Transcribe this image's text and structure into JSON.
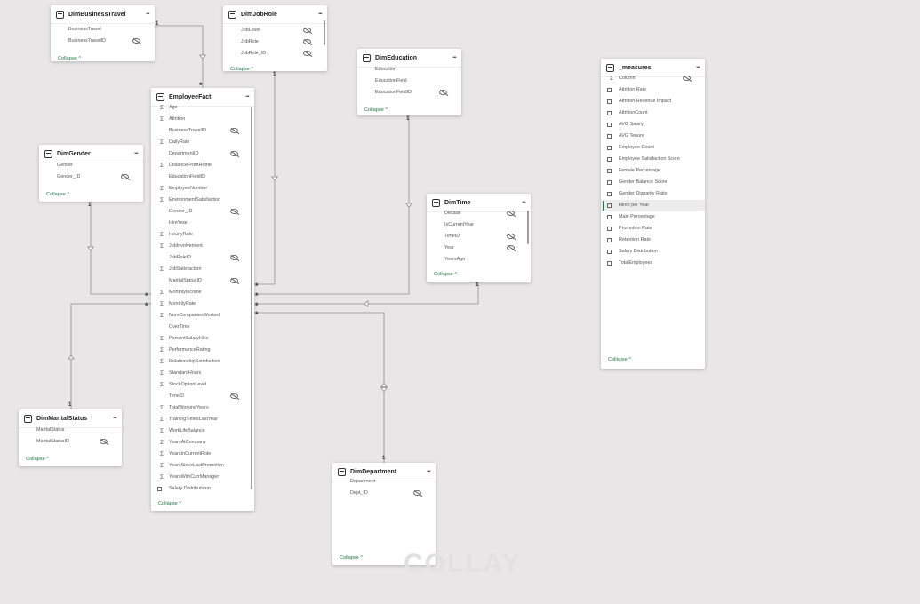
{
  "canvas": {
    "background": "#e8e6e6",
    "line_color": "#a6a6a6",
    "accent": "#217346"
  },
  "tables": {
    "DimBusinessTravel": {
      "title": "DimBusinessTravel",
      "fields": [
        {
          "name": "BusinessTravel",
          "icon": "",
          "hidden": false
        },
        {
          "name": "BusinessTravelID",
          "icon": "",
          "hidden": true
        }
      ],
      "collapse_label": "Collapse ^"
    },
    "DimJobRole": {
      "title": "DimJobRole",
      "fields": [
        {
          "name": "JobLevel",
          "icon": "",
          "hidden": true
        },
        {
          "name": "JobRole",
          "icon": "",
          "hidden": true
        },
        {
          "name": "JobRole_ID",
          "icon": "",
          "hidden": true
        }
      ],
      "collapse_label": "Collapse ^"
    },
    "DimEducation": {
      "title": "DimEducation",
      "fields": [
        {
          "name": "Education",
          "icon": "",
          "hidden": false
        },
        {
          "name": "EducationField",
          "icon": "",
          "hidden": false
        },
        {
          "name": "EducationFieldID",
          "icon": "",
          "hidden": true
        }
      ],
      "collapse_label": "Collapse ^"
    },
    "DimGender": {
      "title": "DimGender",
      "fields": [
        {
          "name": "Gender",
          "icon": "",
          "hidden": false
        },
        {
          "name": "Gender_ID",
          "icon": "",
          "hidden": true
        }
      ],
      "collapse_label": "Collapse ^"
    },
    "EmployeeFact": {
      "title": "EmployeeFact",
      "fields": [
        {
          "name": "Age",
          "icon": "Σ",
          "hidden": false
        },
        {
          "name": "Attrition",
          "icon": "Σ",
          "hidden": false
        },
        {
          "name": "BusinessTravelID",
          "icon": "",
          "hidden": true
        },
        {
          "name": "DailyRate",
          "icon": "Σ",
          "hidden": false
        },
        {
          "name": "DepartmentID",
          "icon": "",
          "hidden": true
        },
        {
          "name": "DistanceFromHome",
          "icon": "Σ",
          "hidden": false
        },
        {
          "name": "EducationFieldID",
          "icon": "",
          "hidden": false
        },
        {
          "name": "EmployeeNumber",
          "icon": "Σ",
          "hidden": false
        },
        {
          "name": "EnvironmentSatisfaction",
          "icon": "Σ",
          "hidden": false
        },
        {
          "name": "Gender_ID",
          "icon": "",
          "hidden": true
        },
        {
          "name": "HireYear",
          "icon": "",
          "hidden": false
        },
        {
          "name": "HourlyRate",
          "icon": "Σ",
          "hidden": false
        },
        {
          "name": "JobInvolvement",
          "icon": "Σ",
          "hidden": false
        },
        {
          "name": "JobRoleID",
          "icon": "",
          "hidden": true
        },
        {
          "name": "JobSatisfaction",
          "icon": "Σ",
          "hidden": false
        },
        {
          "name": "MaritalStatusID",
          "icon": "",
          "hidden": true
        },
        {
          "name": "MonthlyIncome",
          "icon": "Σ",
          "hidden": false
        },
        {
          "name": "MonthlyRate",
          "icon": "Σ",
          "hidden": false
        },
        {
          "name": "NumCompaniesWorked",
          "icon": "Σ",
          "hidden": false
        },
        {
          "name": "OverTime",
          "icon": "",
          "hidden": false
        },
        {
          "name": "PercentSalaryHike",
          "icon": "Σ",
          "hidden": false
        },
        {
          "name": "PerformanceRating",
          "icon": "Σ",
          "hidden": false
        },
        {
          "name": "RelationshipSatisfaction",
          "icon": "Σ",
          "hidden": false
        },
        {
          "name": "StandardHours",
          "icon": "Σ",
          "hidden": false
        },
        {
          "name": "StockOptionLevel",
          "icon": "Σ",
          "hidden": false
        },
        {
          "name": "TimeID",
          "icon": "",
          "hidden": true
        },
        {
          "name": "TotalWorkingYears",
          "icon": "Σ",
          "hidden": false
        },
        {
          "name": "TrainingTimesLastYear",
          "icon": "Σ",
          "hidden": false
        },
        {
          "name": "WorkLifeBalance",
          "icon": "Σ",
          "hidden": false
        },
        {
          "name": "YearsAtCompany",
          "icon": "Σ",
          "hidden": false
        },
        {
          "name": "YearsInCurrentRole",
          "icon": "Σ",
          "hidden": false
        },
        {
          "name": "YearsSinceLastPromotion",
          "icon": "Σ",
          "hidden": false
        },
        {
          "name": "YearsWithCurrManager",
          "icon": "Σ",
          "hidden": false
        },
        {
          "name": "Salary Distributionn",
          "icon": "measure",
          "hidden": false
        }
      ],
      "collapse_label": "Collapse ^"
    },
    "DimTime": {
      "title": "DimTime",
      "fields": [
        {
          "name": "Decade",
          "icon": "",
          "hidden": true
        },
        {
          "name": "IsCurrentYear",
          "icon": "",
          "hidden": false
        },
        {
          "name": "TimeID",
          "icon": "",
          "hidden": true
        },
        {
          "name": "Year",
          "icon": "",
          "hidden": true
        },
        {
          "name": "YearsAgo",
          "icon": "",
          "hidden": false
        }
      ],
      "collapse_label": "Collapse ^"
    },
    "Measures": {
      "title": "_measures",
      "fields": [
        {
          "name": "Column",
          "icon": "Σ",
          "hidden": true
        },
        {
          "name": "Attrition Rate",
          "icon": "measure",
          "hidden": false
        },
        {
          "name": "Attrition Revenue Impact",
          "icon": "measure",
          "hidden": false
        },
        {
          "name": "AttritionCount",
          "icon": "measure",
          "hidden": false
        },
        {
          "name": "AVG Salary",
          "icon": "measure",
          "hidden": false
        },
        {
          "name": "AVG Tenure",
          "icon": "measure",
          "hidden": false
        },
        {
          "name": "Employee Count",
          "icon": "measure",
          "hidden": false
        },
        {
          "name": "Employee Satisfaction Score",
          "icon": "measure",
          "hidden": false
        },
        {
          "name": "Female Percentage",
          "icon": "measure",
          "hidden": false
        },
        {
          "name": "Gender Balance Score",
          "icon": "measure",
          "hidden": false
        },
        {
          "name": "Gender Disparity Ratio",
          "icon": "measure",
          "hidden": false
        },
        {
          "name": "Hires per Year",
          "icon": "measure",
          "hidden": false,
          "selected": true
        },
        {
          "name": "Male Percentage",
          "icon": "measure",
          "hidden": false
        },
        {
          "name": "Promotion Rate",
          "icon": "measure",
          "hidden": false
        },
        {
          "name": "Retention Rate",
          "icon": "measure",
          "hidden": false
        },
        {
          "name": "Salary Distribution",
          "icon": "measure",
          "hidden": false
        },
        {
          "name": "TotalEmployees",
          "icon": "measure",
          "hidden": false
        }
      ],
      "collapse_label": "Collapse ^"
    },
    "DimMaritalStatus": {
      "title": "DimMaritalStatus",
      "fields": [
        {
          "name": "MaritalStatus",
          "icon": "",
          "hidden": false
        },
        {
          "name": "MaritalStatusID",
          "icon": "",
          "hidden": true
        }
      ],
      "collapse_label": "Collapse ^"
    },
    "DimDepartment": {
      "title": "DimDepartment",
      "fields": [
        {
          "name": "Department",
          "icon": "",
          "hidden": false
        },
        {
          "name": "Dept_ID",
          "icon": "",
          "hidden": true
        }
      ],
      "collapse_label": "Collapse ^"
    }
  },
  "cardinality": {
    "one": "1",
    "many": "*"
  },
  "watermark": "COLLAY"
}
